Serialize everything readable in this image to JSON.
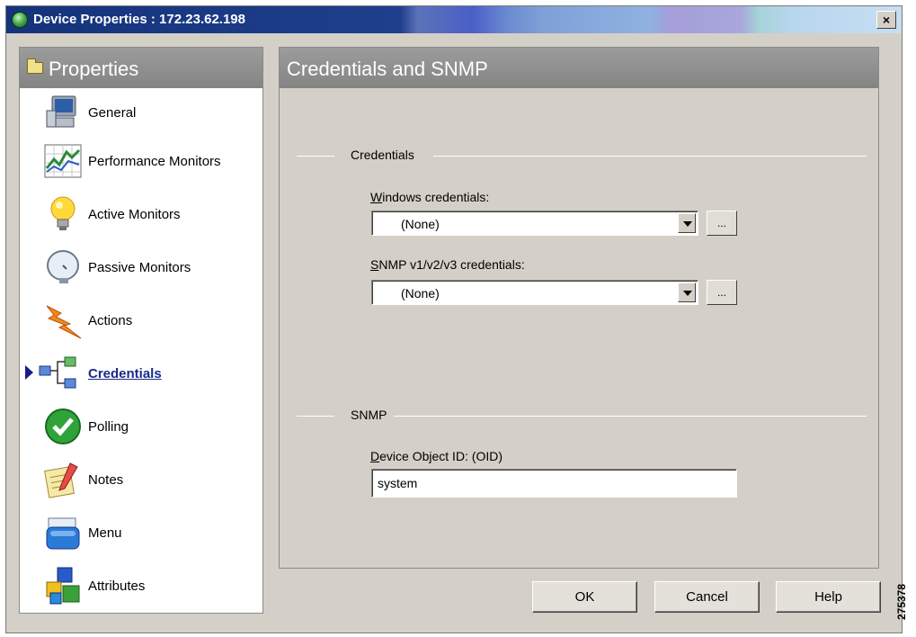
{
  "window": {
    "title": "Device Properties : 172.23.62.198",
    "close_label": "×"
  },
  "sidebar": {
    "title": "Properties",
    "items": [
      {
        "label": "General",
        "icon": "computer-icon"
      },
      {
        "label": "Performance Monitors",
        "icon": "chart-icon"
      },
      {
        "label": "Active Monitors",
        "icon": "lightbulb-icon"
      },
      {
        "label": "Passive Monitors",
        "icon": "satellite-dish-icon"
      },
      {
        "label": "Actions",
        "icon": "lightning-icon"
      },
      {
        "label": "Credentials",
        "icon": "network-icon",
        "selected": true
      },
      {
        "label": "Polling",
        "icon": "checkmark-icon"
      },
      {
        "label": "Notes",
        "icon": "notepad-icon"
      },
      {
        "label": "Menu",
        "icon": "menu-folder-icon"
      },
      {
        "label": "Attributes",
        "icon": "blocks-icon"
      }
    ]
  },
  "main": {
    "title": "Credentials and SNMP",
    "credentials_group": {
      "title": "Credentials",
      "windows_label_acc": "W",
      "windows_label_rest": "indows credentials:",
      "windows_value": "(None)",
      "snmp_label_acc": "S",
      "snmp_label_rest": "NMP v1/v2/v3 credentials:",
      "snmp_value": "(None)",
      "browse_label": "..."
    },
    "snmp_group": {
      "title": "SNMP",
      "oid_label_acc": "D",
      "oid_label_rest": "evice Object ID:  (OID)",
      "oid_value": "system"
    }
  },
  "buttons": {
    "ok": "OK",
    "cancel": "Cancel",
    "help": "Help"
  },
  "figure_id": "275378",
  "colors": {
    "selected_text": "#1a2a8a",
    "header_gray": "#9c9c9c",
    "dialog_bg": "#d4d0c8"
  }
}
